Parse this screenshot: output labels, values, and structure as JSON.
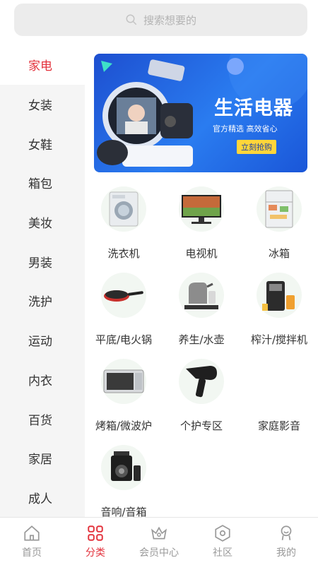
{
  "search": {
    "placeholder": "搜索想要的"
  },
  "sidebar": {
    "items": [
      {
        "label": "家电",
        "active": true
      },
      {
        "label": "女装"
      },
      {
        "label": "女鞋"
      },
      {
        "label": "箱包"
      },
      {
        "label": "美妆"
      },
      {
        "label": "男装"
      },
      {
        "label": "洗护"
      },
      {
        "label": "运动"
      },
      {
        "label": "内衣"
      },
      {
        "label": "百货"
      },
      {
        "label": "家居"
      },
      {
        "label": "成人"
      }
    ]
  },
  "banner": {
    "title": "生活电器",
    "subtitle": "官方精选 高效省心",
    "button": "立刻抢购"
  },
  "products": [
    {
      "label": "洗衣机",
      "icon": "washing-machine-icon"
    },
    {
      "label": "电视机",
      "icon": "tv-icon"
    },
    {
      "label": "冰箱",
      "icon": "fridge-icon"
    },
    {
      "label": "平底/电火锅",
      "icon": "pan-icon"
    },
    {
      "label": "养生/水壶",
      "icon": "kettle-icon"
    },
    {
      "label": "榨汁/搅拌机",
      "icon": "juicer-icon"
    },
    {
      "label": "烤箱/微波炉",
      "icon": "microwave-icon"
    },
    {
      "label": "个护专区",
      "icon": "hair-dryer-icon"
    },
    {
      "label": "家庭影音",
      "icon": ""
    },
    {
      "label": "音响/音箱",
      "icon": "speaker-icon"
    }
  ],
  "tabbar": {
    "items": [
      {
        "label": "首页",
        "icon": "home-icon"
      },
      {
        "label": "分类",
        "icon": "category-icon",
        "active": true
      },
      {
        "label": "会员中心",
        "icon": "crown-icon"
      },
      {
        "label": "社区",
        "icon": "hexagon-icon"
      },
      {
        "label": "我的",
        "icon": "user-icon"
      }
    ]
  },
  "colors": {
    "accent": "#e3323c",
    "banner": "#2a7cf0",
    "sidebar_bg": "#f5f5f5"
  }
}
